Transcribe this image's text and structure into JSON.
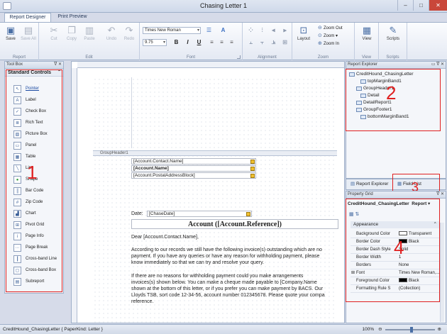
{
  "window": {
    "title": "Chasing Letter 1",
    "controls": [
      "–",
      "□",
      "✕"
    ]
  },
  "tabs": [
    {
      "label": "Report Designer",
      "active": true
    },
    {
      "label": "Print Preview",
      "active": false
    }
  ],
  "ribbon": {
    "groups": {
      "report": "Report",
      "edit": "Edit",
      "font": "Font",
      "alignment": "Alignment",
      "zoom": "Zoom",
      "view": "View",
      "scripts": "Scripts"
    },
    "buttons": {
      "save": "Save",
      "save_all": "Save All",
      "cut": "Cut",
      "copy": "Copy",
      "paste": "Paste",
      "undo": "Undo",
      "redo": "Redo",
      "layout": "Layout",
      "view": "View",
      "scripts": "Scripts"
    },
    "font_name": "Times New Roman",
    "font_size": "9.75",
    "format": {
      "bold": "B",
      "italic": "I",
      "underline": "U"
    },
    "zoom": {
      "zoom_out": "Zoom Out",
      "zoom": "Zoom",
      "zoom_in": "Zoom In"
    }
  },
  "toolbox": {
    "header": "Tool Box",
    "section": "Standard Controls",
    "items": [
      "Pointer",
      "Label",
      "Check Box",
      "Rich Text",
      "Picture Box",
      "Panel",
      "Table",
      "Line",
      "Shape",
      "Bar Code",
      "Zip Code",
      "Chart",
      "Pivot Grid",
      "Page Info",
      "Page Break",
      "Cross-band Line",
      "Cross-band Box",
      "Subreport"
    ]
  },
  "design": {
    "band": "GroupHeader1",
    "fields": {
      "contact_name": "[Account.Contact.Name]",
      "account_name": "[Account.Name]",
      "postal": "[Account.PostalAddressBlock]",
      "date_label": "Date:",
      "chase_date": "[ChaseDate]",
      "heading": "Account ([Account.Reference])",
      "salutation": "Dear [Account.Contact.Name],"
    },
    "paragraph1": [
      "According to our records we still have the following invoice(s) outstanding which are no",
      "payment. If you have any queries or have any reason for withholding payment, please",
      "know immediately so that we can try and resolve your query."
    ],
    "paragraph2": [
      "If there are no reasons for withholding payment could you make arrangements",
      "invoices(s) shown below. You can make a cheque made payable to [Company.Name",
      "shown at the bottom of this letter, or if you prefer you can make payment by BACS. Our",
      "Lloyds TSB, sort code 12-34-56, account number 012345678. Please quote your compa",
      "reference."
    ]
  },
  "explorer": {
    "header": "Report Explorer",
    "root": "CreditHound_ChasingLetter",
    "items": [
      "topMarginBand1",
      "GroupHeader1",
      "Detail",
      "DetailReport1",
      "GroupFooter1",
      "bottomMarginBand1"
    ],
    "tabs": [
      "Report Explorer",
      "Field List"
    ]
  },
  "properties": {
    "header": "Property Grid",
    "object": "CreditHound_ChasingLetter",
    "object_type": "Report",
    "category": "Appearance",
    "rows": [
      {
        "key": "Background Color",
        "value": "Transparent",
        "swatch": "#ffffff"
      },
      {
        "key": "Border Color",
        "value": "Black",
        "swatch": "#000000"
      },
      {
        "key": "Border Dash Style",
        "value": "Solid"
      },
      {
        "key": "Border Width",
        "value": "1"
      },
      {
        "key": "Borders",
        "value": "None"
      },
      {
        "key": "Font",
        "value": "Times New Roman,..."
      },
      {
        "key": "Foreground Color",
        "value": "Black",
        "swatch": "#000000"
      },
      {
        "key": "Formatting Rule S",
        "value": "(Collection)"
      }
    ]
  },
  "annotations": [
    "1",
    "2",
    "3",
    "4"
  ],
  "status": {
    "text": "CreditHound_ChasingLetter { PaperKind: Letter }",
    "zoom": "100%"
  }
}
